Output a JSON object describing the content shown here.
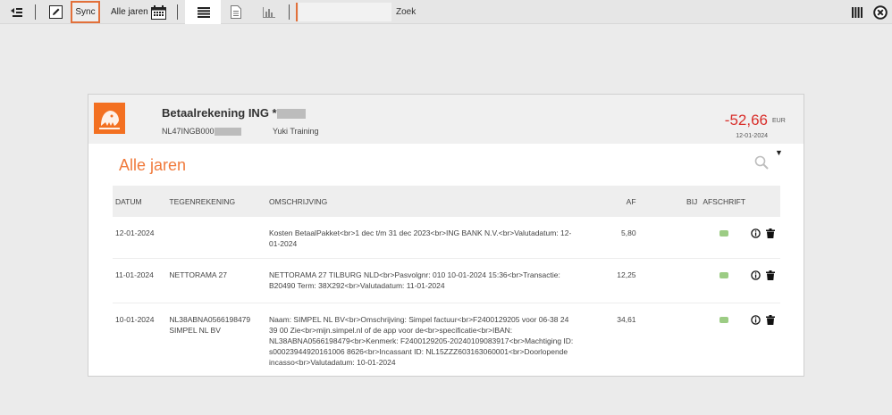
{
  "toolbar": {
    "sync_label": "Sync",
    "years_label": "Alle jaren",
    "search_placeholder": "",
    "search_button": "Zoek"
  },
  "account": {
    "name": "Betaalrekening ING *",
    "iban": "NL47INGB000",
    "owner": "Yuki Training",
    "balance": "-52,66",
    "currency": "EUR",
    "balance_date": "12-01-2024"
  },
  "section_title": "Alle jaren",
  "table": {
    "headers": {
      "date": "DATUM",
      "counter": "TEGENREKENING",
      "desc": "OMSCHRIJVING",
      "debit": "AF",
      "credit": "BIJ",
      "statement": "AFSCHRIFT"
    },
    "rows": [
      {
        "date": "12-01-2024",
        "counter_iban": "",
        "counter_name": "",
        "desc": "Kosten BetaalPakket<br>1 dec t/m 31 dec 2023<br>ING BANK N.V.<br>Valutadatum: 12-01-2024",
        "debit": "5,80",
        "credit": ""
      },
      {
        "date": "11-01-2024",
        "counter_iban": "NETTORAMA 27",
        "counter_name": "",
        "desc": "NETTORAMA 27 TILBURG NLD<br>Pasvolgnr: 010 10-01-2024 15:36<br>Transactie: B20490 Term: 38X292<br>Valutadatum: 11-01-2024",
        "debit": "12,25",
        "credit": ""
      },
      {
        "date": "10-01-2024",
        "counter_iban": "NL38ABNA0566198479",
        "counter_name": "SIMPEL NL BV",
        "desc": "Naam: SIMPEL NL BV<br>Omschrijving: Simpel factuur<br>F2400129205 voor 06-38 24 39 00 Zie<br>mijn.simpel.nl of de app voor de<br>specificatie<br>IBAN: NL38ABNA0566198479<br>Kenmerk: F2400129205-20240109083917<br>Machtiging ID: s00023944920161006 8626<br>Incassant ID: NL15ZZZ603163060001<br>Doorlopende incasso<br>Valutadatum: 10-01-2024",
        "debit": "34,61",
        "credit": ""
      }
    ]
  },
  "colors": {
    "accent": "#e2703a",
    "title_orange": "#f07a3c",
    "negative_red": "#d9302c",
    "ing_orange": "#f37021",
    "receipt_green": "#9ccc84"
  },
  "icons": {
    "collapse": "collapse-list-icon",
    "edit": "edit-icon",
    "calendar": "calendar-icon",
    "list_view": "list-view-icon",
    "document_view": "document-view-icon",
    "chart_view": "bar-chart-icon",
    "columns": "columns-icon",
    "close": "close-circle-icon",
    "search": "search-icon",
    "info": "info-icon",
    "delete": "trash-icon",
    "statement": "receipt-icon"
  }
}
